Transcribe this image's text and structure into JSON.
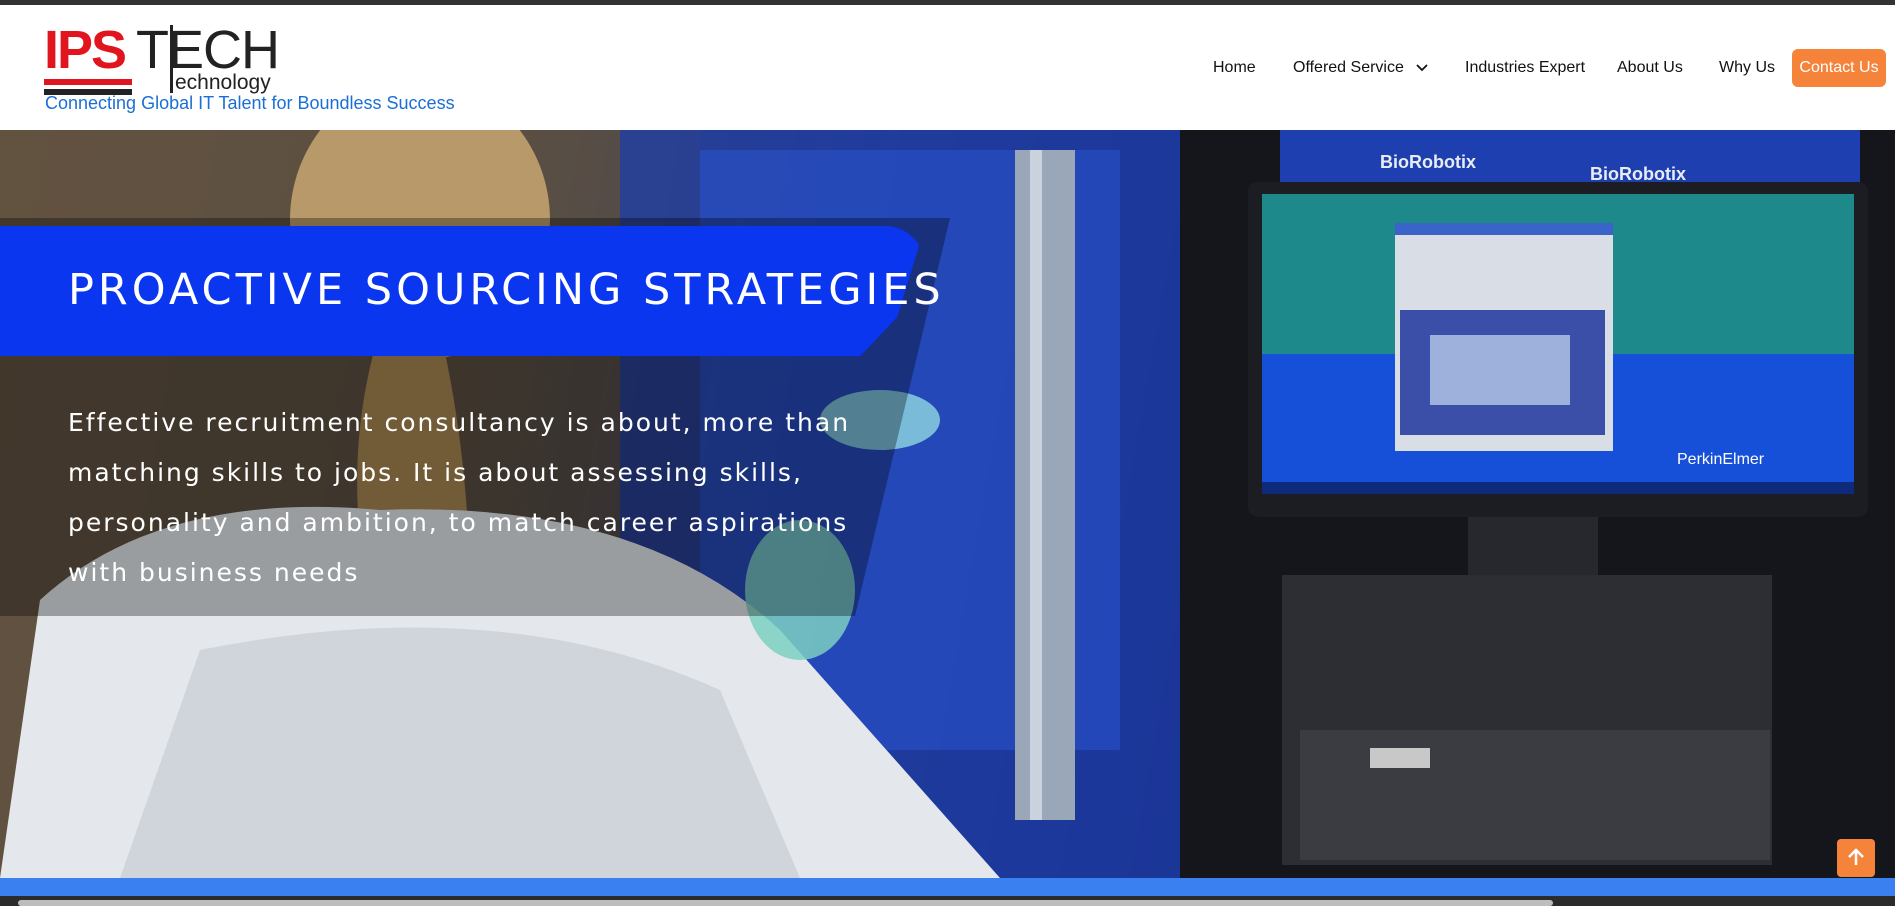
{
  "logo": {
    "brand_red": "IPS",
    "brand_dark": "TECH",
    "brand_sub": "echnology",
    "tagline": "Connecting Global IT Talent for Boundless Success"
  },
  "nav": {
    "items": [
      "Home",
      "Offered Service",
      "Industries Expert",
      "About Us",
      "Why Us"
    ],
    "contact": "Contact Us"
  },
  "hero": {
    "title": "PROACTIVE SOURCING STRATEGIES",
    "text": "Effective recruitment consultancy is about, more than matching skills to jobs. It is about assessing skills, personality and ambition, to match career aspirations with business needs",
    "image_labels": {
      "biorobotix_1": "BioRobotix",
      "biorobotix_2": "BioRobotix",
      "perkinelmer": "PerkinElmer"
    }
  },
  "icons": {
    "dropdown": "chevron-down-icon",
    "scroll_top": "arrow-up-icon"
  },
  "colors": {
    "accent_orange": "#f5843a",
    "title_blue": "#0a36f0",
    "tagline_blue": "#1a6fd6",
    "brand_red": "#e0151d",
    "band_blue": "#3b80f0"
  }
}
